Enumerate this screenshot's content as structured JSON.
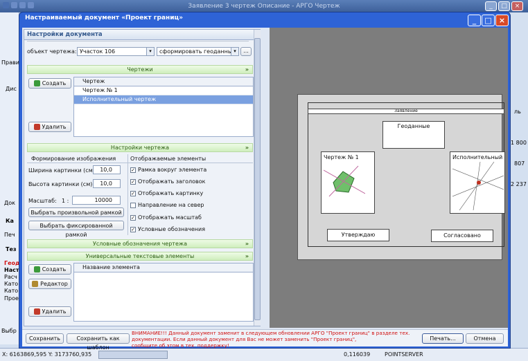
{
  "background": {
    "title": "Заявление 3 чертеж Описание - АРГО Чертеж",
    "side_labels": [
      "Прави",
      "Дис",
      "Док",
      "Ка",
      "Печ",
      "Тез",
      "Геод",
      "Наст",
      "Расч",
      "Като",
      "Като",
      "Прое",
      "Выбр"
    ],
    "right_labels": [
      "ль",
      "1 800",
      "807",
      "2 237"
    ]
  },
  "status": {
    "coords": "X: 6163869,595 Y: 3173760,935",
    "scale": "0,116039",
    "server": "POINTSERVER"
  },
  "dialog": {
    "title": "Настраиваемый документ «Проект границ»",
    "settings_header": "Настройки документа",
    "object_label": "объект чертежа:",
    "object_value": "Участок 106",
    "action_value": "сформировать геоданные",
    "drawings": {
      "header": "Чертежи",
      "create": "Создать",
      "delete": "Удалить",
      "column": "Чертеж",
      "rows": [
        "Чертеж № 1",
        "Исполнительный чертеж"
      ]
    },
    "drawing_settings": {
      "header": "Настройки чертежа",
      "image_section": "Формирование изображения",
      "width_label": "Ширина картинки (см):",
      "width_value": "10,0",
      "height_label": "Высота картинки (см):",
      "height_value": "10,0",
      "scale_label": "Масштаб:",
      "scale_prefix": "1 :",
      "scale_value": "10000",
      "btn_arbitrary": "Выбрать произвольной рамкой",
      "btn_fixed": "Выбрать фиксированной рамкой",
      "elements_section": "Отображаемые элементы",
      "checkboxes": [
        {
          "label": "Рамка вокруг элемента",
          "checked": true
        },
        {
          "label": "Отображать заголовок",
          "checked": true
        },
        {
          "label": "Отображать картинку",
          "checked": true
        },
        {
          "label": "Направление на север",
          "checked": false
        },
        {
          "label": "Отображать масштаб",
          "checked": true
        },
        {
          "label": "Условные обозначения",
          "checked": true
        }
      ]
    },
    "legend_header": "Условные обозначения чертежа",
    "texts": {
      "header": "Универсальные текстовые элементы",
      "create": "Создать",
      "editor": "Редактор",
      "delete": "Удалить",
      "column": "Название элемента"
    },
    "preview": {
      "page_header": "Заявление",
      "geodata": "Геоданные",
      "drawing1": "Чертеж № 1",
      "exec_drawing": "Исполнительный чер",
      "approve": "Утверждаю",
      "agreed": "Согласовано"
    },
    "footer": {
      "save": "Сохранить",
      "save_template": "Сохранить как шаблон",
      "warning_lines": [
        "ВНИМАНИЕ!!! Данный документ заменит в следующем обновлении АРГО \"Проект границ\" в разделе тех.",
        "документации. Если данный документ для Вас не может заменить \"Проект границ\",",
        "сообщите об этом в тех. поддержку!"
      ],
      "print": "Печать...",
      "cancel": "Отмена"
    }
  }
}
